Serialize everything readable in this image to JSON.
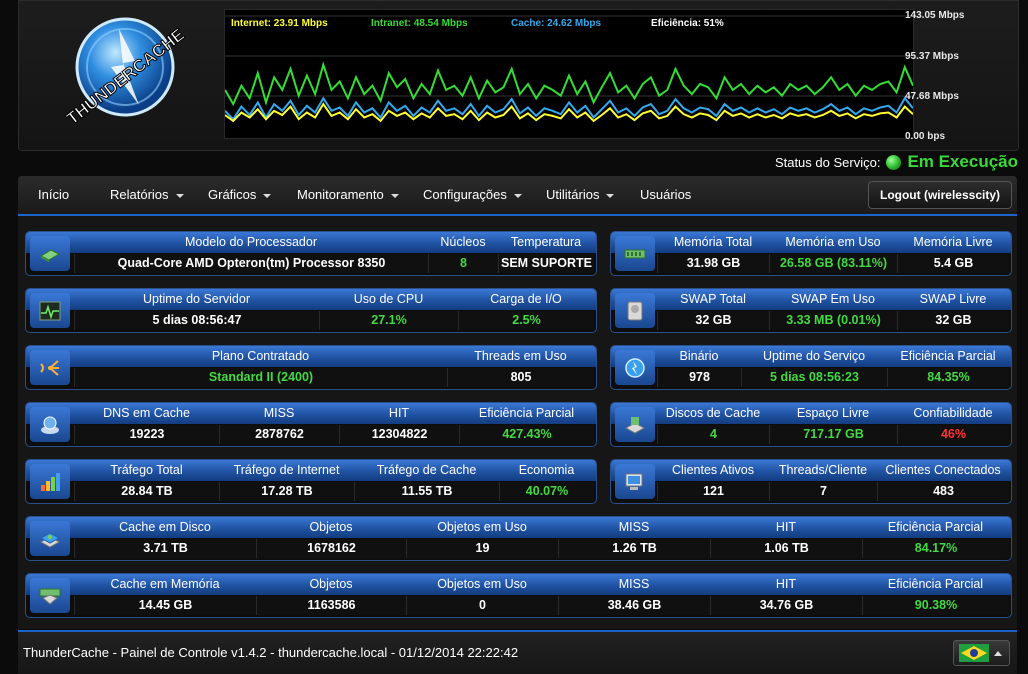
{
  "header": {
    "logo_text": "THUNDERCACHE",
    "legend": [
      {
        "label": "Internet: 23.91 Mbps",
        "color": "#ffff33"
      },
      {
        "label": "Intranet: 48.54 Mbps",
        "color": "#33dd33"
      },
      {
        "label": "Cache: 24.62 Mbps",
        "color": "#33aaee"
      },
      {
        "label": "Eficiência: 51%",
        "color": "#ffffff"
      }
    ],
    "y_labels": [
      "143.05 Mbps",
      "95.37 Mbps",
      "47.68 Mbps",
      "0.00 bps"
    ]
  },
  "chart_data": {
    "type": "line",
    "ylabel": "",
    "ylim": [
      0,
      143.05
    ],
    "y_ticks": [
      "143.05 Mbps",
      "95.37 Mbps",
      "47.68 Mbps",
      "0.00 bps"
    ],
    "series": [
      {
        "name": "Intranet",
        "color": "#33dd33",
        "values": [
          55,
          38,
          60,
          45,
          75,
          40,
          70,
          55,
          80,
          48,
          72,
          50,
          85,
          55,
          65,
          45,
          70,
          50,
          60,
          42,
          75,
          58,
          68,
          45,
          62,
          50,
          78,
          55,
          60,
          48,
          70,
          45,
          66,
          52,
          58,
          80,
          50,
          62,
          45,
          60,
          55,
          48,
          72,
          50,
          65,
          40,
          58,
          75,
          52,
          60,
          45,
          62,
          70,
          48,
          55,
          80,
          60,
          50,
          62,
          58,
          45,
          70,
          55,
          62,
          50,
          60,
          52,
          58,
          48,
          62,
          55,
          60,
          50,
          58,
          70,
          55,
          62,
          48,
          60,
          55,
          62,
          65,
          52,
          82,
          60
        ]
      },
      {
        "name": "Cache",
        "color": "#33aaee",
        "values": [
          30,
          20,
          35,
          25,
          40,
          22,
          38,
          30,
          42,
          25,
          36,
          28,
          45,
          30,
          34,
          24,
          40,
          28,
          33,
          22,
          40,
          30,
          36,
          24,
          34,
          28,
          42,
          30,
          33,
          26,
          38,
          24,
          36,
          28,
          32,
          44,
          27,
          34,
          24,
          33,
          30,
          26,
          40,
          28,
          36,
          22,
          32,
          42,
          28,
          33,
          24,
          34,
          38,
          26,
          30,
          44,
          33,
          28,
          34,
          32,
          24,
          38,
          30,
          34,
          28,
          33,
          28,
          32,
          26,
          34,
          30,
          33,
          28,
          32,
          38,
          30,
          34,
          26,
          33,
          30,
          34,
          36,
          28,
          45,
          33
        ]
      },
      {
        "name": "Internet",
        "color": "#ffff33",
        "values": [
          25,
          18,
          28,
          22,
          32,
          20,
          30,
          25,
          35,
          20,
          28,
          22,
          38,
          24,
          28,
          20,
          32,
          22,
          26,
          18,
          30,
          24,
          28,
          20,
          27,
          22,
          33,
          24,
          26,
          20,
          30,
          19,
          28,
          22,
          25,
          35,
          21,
          27,
          19,
          26,
          24,
          21,
          32,
          22,
          28,
          18,
          25,
          33,
          22,
          26,
          19,
          27,
          30,
          21,
          24,
          35,
          26,
          22,
          27,
          25,
          19,
          30,
          24,
          27,
          22,
          26,
          22,
          25,
          21,
          27,
          24,
          26,
          22,
          25,
          30,
          24,
          27,
          21,
          26,
          24,
          27,
          28,
          22,
          35,
          26
        ]
      }
    ]
  },
  "status": {
    "label": "Status do Serviço:",
    "value": "Em Execução"
  },
  "nav": {
    "items": [
      "Início",
      "Relatórios",
      "Gráficos",
      "Monitoramento",
      "Configurações",
      "Utilitários",
      "Usuários"
    ],
    "logout": "Logout (wirelesscity)"
  },
  "panels": {
    "processador": {
      "headers": [
        "Modelo do Processador",
        "Núcleos",
        "Temperatura"
      ],
      "values": [
        "Quad-Core AMD Opteron(tm) Processor 8350",
        "8",
        "SEM SUPORTE"
      ]
    },
    "memoria": {
      "headers": [
        "Memória Total",
        "Memória em Uso",
        "Memória Livre"
      ],
      "values": [
        "31.98 GB",
        "26.58 GB (83.11%)",
        "5.4 GB"
      ]
    },
    "uptime": {
      "headers": [
        "Uptime do Servidor",
        "Uso de CPU",
        "Carga de I/O"
      ],
      "values": [
        "5 dias 08:56:47",
        "27.1%",
        "2.5%"
      ]
    },
    "swap": {
      "headers": [
        "SWAP Total",
        "SWAP Em Uso",
        "SWAP Livre"
      ],
      "values": [
        "32 GB",
        "3.33 MB (0.01%)",
        "32 GB"
      ]
    },
    "plano": {
      "headers": [
        "Plano Contratado",
        "Threads em Uso"
      ],
      "values": [
        "Standard II (2400)",
        "805"
      ]
    },
    "binario": {
      "headers": [
        "Binário",
        "Uptime do Serviço",
        "Eficiência Parcial"
      ],
      "values": [
        "978",
        "5 dias 08:56:23",
        "84.35%"
      ]
    },
    "dns": {
      "headers": [
        "DNS em Cache",
        "MISS",
        "HIT",
        "Eficiência Parcial"
      ],
      "values": [
        "19223",
        "2878762",
        "12304822",
        "427.43%"
      ]
    },
    "discos": {
      "headers": [
        "Discos de Cache",
        "Espaço Livre",
        "Confiabilidade"
      ],
      "values": [
        "4",
        "717.17 GB",
        "46%"
      ]
    },
    "trafego": {
      "headers": [
        "Tráfego Total",
        "Tráfego de Internet",
        "Tráfego de Cache",
        "Economia"
      ],
      "values": [
        "28.84 TB",
        "17.28 TB",
        "11.55 TB",
        "40.07%"
      ]
    },
    "clientes": {
      "headers": [
        "Clientes Ativos",
        "Threads/Cliente",
        "Clientes Conectados"
      ],
      "values": [
        "121",
        "7",
        "483"
      ]
    },
    "disco": {
      "headers": [
        "Cache em Disco",
        "Objetos",
        "Objetos em Uso",
        "MISS",
        "HIT",
        "Eficiência Parcial"
      ],
      "values": [
        "3.71 TB",
        "1678162",
        "19",
        "1.26 TB",
        "1.06 TB",
        "84.17%"
      ]
    },
    "memoria_cache": {
      "headers": [
        "Cache em Memória",
        "Objetos",
        "Objetos em Uso",
        "MISS",
        "HIT",
        "Eficiência Parcial"
      ],
      "values": [
        "14.45 GB",
        "1163586",
        "0",
        "38.46 GB",
        "34.76 GB",
        "90.38%"
      ]
    }
  },
  "footer": {
    "text": "ThunderCache - Painel de Controle v1.4.2 - thundercache.local - 01/12/2014 22:22:42"
  },
  "colors": {
    "accent": "#1e64c8",
    "green": "#43d943",
    "red": "#ff3030"
  }
}
